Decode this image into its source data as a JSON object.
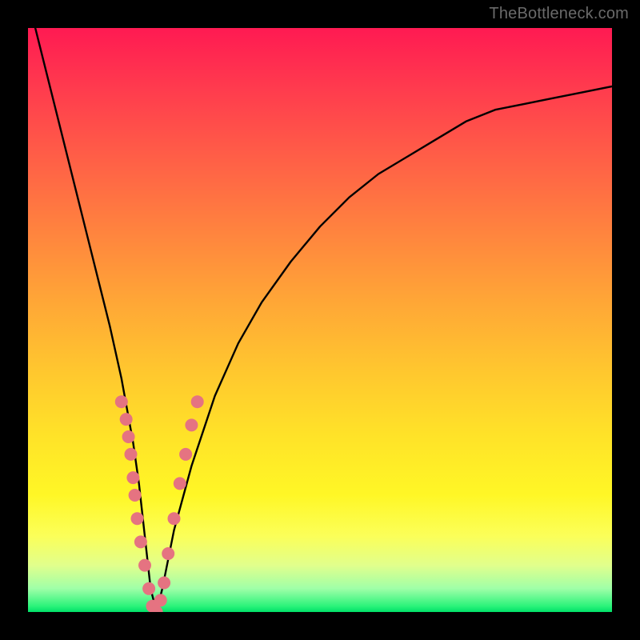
{
  "watermark": "TheBottleneck.com",
  "chart_data": {
    "type": "line",
    "title": "",
    "xlabel": "",
    "ylabel": "",
    "xlim": [
      0,
      100
    ],
    "ylim": [
      0,
      100
    ],
    "grid": false,
    "legend": false,
    "series": [
      {
        "name": "bottleneck-curve",
        "x": [
          0,
          2,
          4,
          6,
          8,
          10,
          12,
          14,
          16,
          18,
          19,
          20,
          21,
          22,
          23,
          25,
          28,
          32,
          36,
          40,
          45,
          50,
          55,
          60,
          65,
          70,
          75,
          80,
          85,
          90,
          95,
          100
        ],
        "values": [
          105,
          97,
          89,
          81,
          73,
          65,
          57,
          49,
          40,
          29,
          22,
          13,
          4,
          0,
          4,
          14,
          25,
          37,
          46,
          53,
          60,
          66,
          71,
          75,
          78,
          81,
          84,
          86,
          87,
          88,
          89,
          90
        ]
      }
    ],
    "markers": {
      "name": "highlight-points",
      "color": "#e57381",
      "points": [
        {
          "x": 16.0,
          "y": 36
        },
        {
          "x": 16.8,
          "y": 33
        },
        {
          "x": 17.2,
          "y": 30
        },
        {
          "x": 17.6,
          "y": 27
        },
        {
          "x": 18.0,
          "y": 23
        },
        {
          "x": 18.3,
          "y": 20
        },
        {
          "x": 18.7,
          "y": 16
        },
        {
          "x": 19.3,
          "y": 12
        },
        {
          "x": 20.0,
          "y": 8
        },
        {
          "x": 20.7,
          "y": 4
        },
        {
          "x": 21.3,
          "y": 1
        },
        {
          "x": 22.0,
          "y": 0
        },
        {
          "x": 22.7,
          "y": 2
        },
        {
          "x": 23.3,
          "y": 5
        },
        {
          "x": 24.0,
          "y": 10
        },
        {
          "x": 25.0,
          "y": 16
        },
        {
          "x": 26.0,
          "y": 22
        },
        {
          "x": 27.0,
          "y": 27
        },
        {
          "x": 28.0,
          "y": 32
        },
        {
          "x": 29.0,
          "y": 36
        }
      ]
    },
    "background_gradient_stops": [
      {
        "pos": 0.0,
        "color": "#ff1a52"
      },
      {
        "pos": 0.5,
        "color": "#ffbf30"
      },
      {
        "pos": 0.85,
        "color": "#fdff40"
      },
      {
        "pos": 1.0,
        "color": "#00e068"
      }
    ]
  }
}
